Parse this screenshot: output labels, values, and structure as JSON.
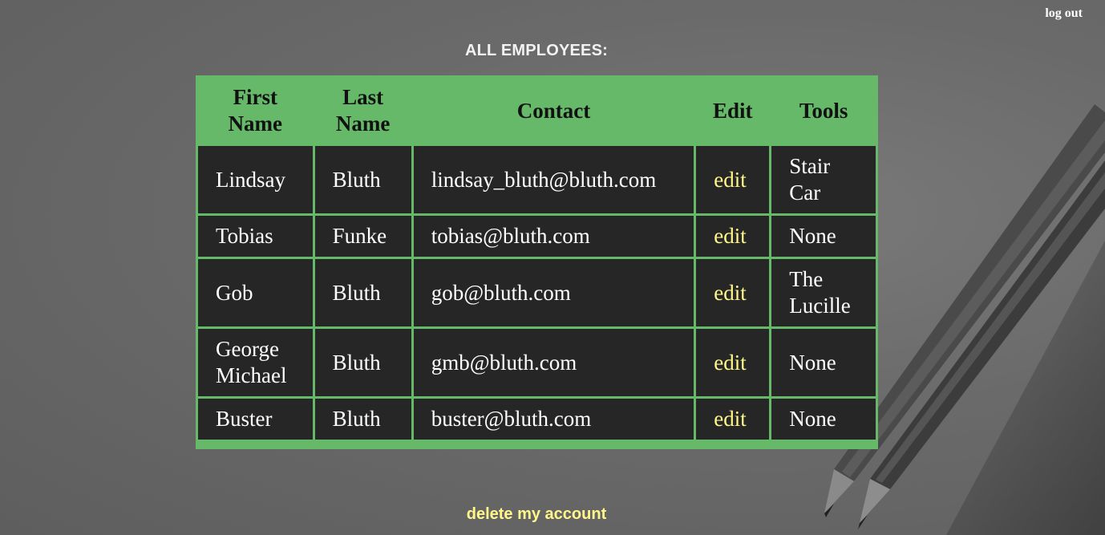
{
  "header": {
    "logout_label": "log out",
    "title": "ALL EMPLOYEES:"
  },
  "table": {
    "columns": [
      "First Name",
      "Last Name",
      "Contact",
      "Edit",
      "Tools"
    ],
    "rows": [
      {
        "first": "Lindsay",
        "last": "Bluth",
        "contact": "lindsay_bluth@bluth.com",
        "edit": "edit",
        "tools": "Stair Car"
      },
      {
        "first": "Tobias",
        "last": "Funke",
        "contact": "tobias@bluth.com",
        "edit": "edit",
        "tools": "None"
      },
      {
        "first": "Gob",
        "last": "Bluth",
        "contact": "gob@bluth.com",
        "edit": "edit",
        "tools": "The Lucille"
      },
      {
        "first": "George Michael",
        "last": "Bluth",
        "contact": "gmb@bluth.com",
        "edit": "edit",
        "tools": "None"
      },
      {
        "first": "Buster",
        "last": "Bluth",
        "contact": "buster@bluth.com",
        "edit": "edit",
        "tools": "None"
      }
    ]
  },
  "footer": {
    "delete_label": "delete my account"
  },
  "colors": {
    "table_green": "#67b96a",
    "cell_dark": "#262626",
    "link_yellow": "#fff78a"
  }
}
